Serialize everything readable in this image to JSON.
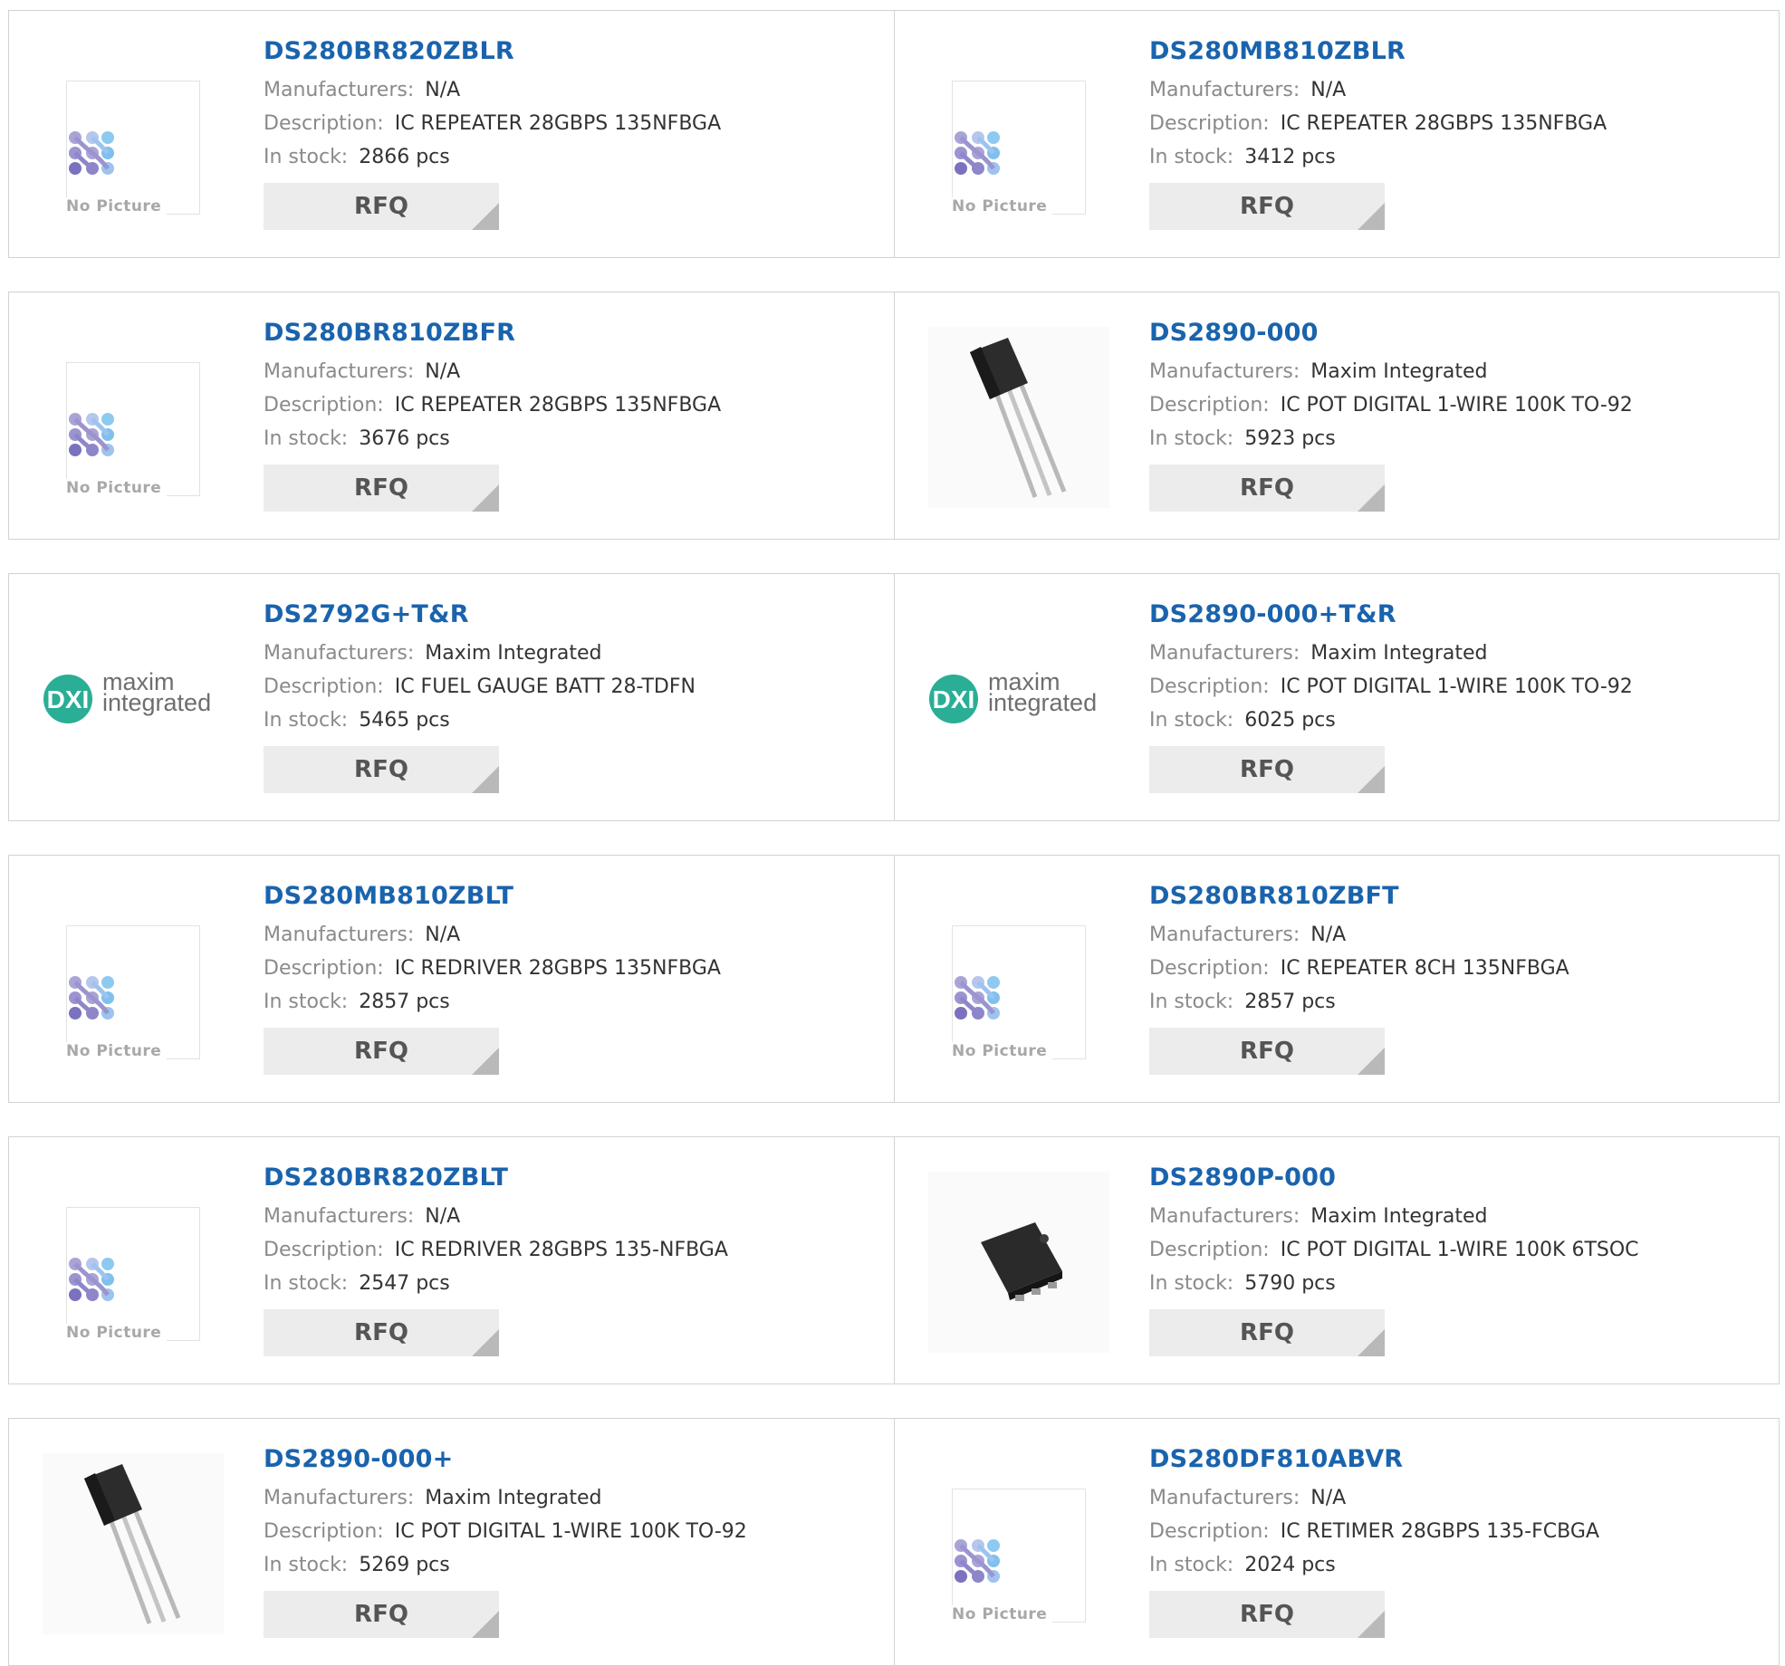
{
  "labels": {
    "manufacturers": "Manufacturers:",
    "description": "Description:",
    "in_stock": "In stock:",
    "rfq": "RFQ",
    "no_picture": "No Picture",
    "maxim_line1": "maxim",
    "maxim_line2": "integrated"
  },
  "colors": {
    "link": "#1a63ad",
    "rfq_bg": "#ececec",
    "border": "#d2d2d2",
    "maxim_teal": "#2aae96"
  },
  "products": [
    {
      "part": "DS280BR820ZBLR",
      "manufacturer": "N/A",
      "description": "IC REPEATER 28GBPS 135NFBGA",
      "stock": "2866 pcs",
      "image": "no-picture"
    },
    {
      "part": "DS280MB810ZBLR",
      "manufacturer": "N/A",
      "description": "IC REPEATER 28GBPS 135NFBGA",
      "stock": "3412 pcs",
      "image": "no-picture"
    },
    {
      "part": "DS280BR810ZBFR",
      "manufacturer": "N/A",
      "description": "IC REPEATER 28GBPS 135NFBGA",
      "stock": "3676 pcs",
      "image": "no-picture"
    },
    {
      "part": "DS2890-000",
      "manufacturer": "Maxim Integrated",
      "description": "IC POT DIGITAL 1-WIRE 100K TO-92",
      "stock": "5923 pcs",
      "image": "to-92"
    },
    {
      "part": "DS2792G+T&R",
      "manufacturer": "Maxim Integrated",
      "description": "IC FUEL GAUGE BATT 28-TDFN",
      "stock": "5465 pcs",
      "image": "maxim-logo"
    },
    {
      "part": "DS2890-000+T&R",
      "manufacturer": "Maxim Integrated",
      "description": "IC POT DIGITAL 1-WIRE 100K TO-92",
      "stock": "6025 pcs",
      "image": "maxim-logo"
    },
    {
      "part": "DS280MB810ZBLT",
      "manufacturer": "N/A",
      "description": "IC REDRIVER 28GBPS 135NFBGA",
      "stock": "2857 pcs",
      "image": "no-picture"
    },
    {
      "part": "DS280BR810ZBFT",
      "manufacturer": "N/A",
      "description": "IC REPEATER 8CH 135NFBGA",
      "stock": "2857 pcs",
      "image": "no-picture"
    },
    {
      "part": "DS280BR820ZBLT",
      "manufacturer": "N/A",
      "description": "IC REDRIVER 28GBPS 135-NFBGA",
      "stock": "2547 pcs",
      "image": "no-picture"
    },
    {
      "part": "DS2890P-000",
      "manufacturer": "Maxim Integrated",
      "description": "IC POT DIGITAL 1-WIRE 100K 6TSOC",
      "stock": "5790 pcs",
      "image": "tsoc"
    },
    {
      "part": "DS2890-000+",
      "manufacturer": "Maxim Integrated",
      "description": "IC POT DIGITAL 1-WIRE 100K TO-92",
      "stock": "5269 pcs",
      "image": "to-92"
    },
    {
      "part": "DS280DF810ABVR",
      "manufacturer": "N/A",
      "description": "IC RETIMER 28GBPS 135-FCBGA",
      "stock": "2024 pcs",
      "image": "no-picture"
    }
  ]
}
